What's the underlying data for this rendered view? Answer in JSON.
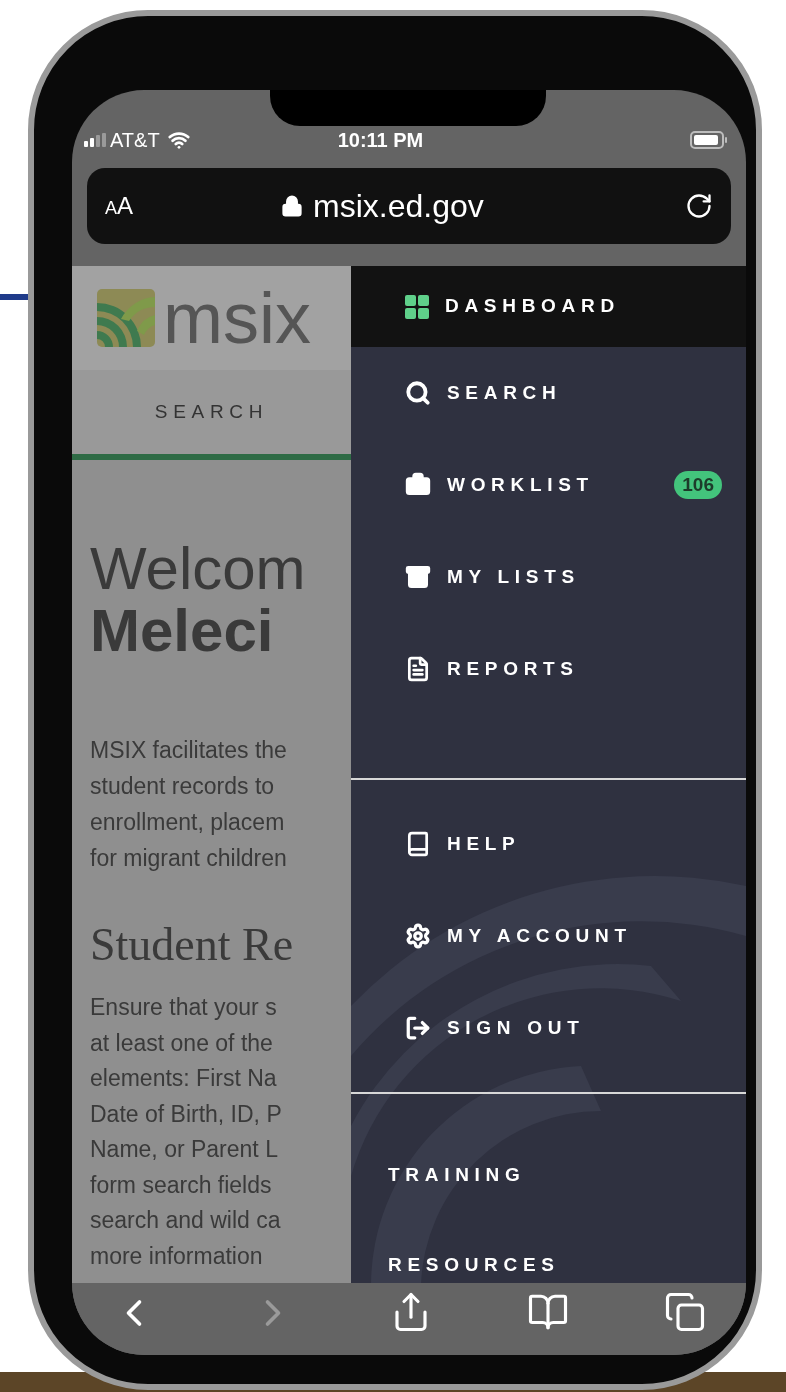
{
  "status_bar": {
    "carrier": "AT&T",
    "time": "10:11 PM"
  },
  "address_bar": {
    "text_size_button": "AA",
    "url": "msix.ed.gov"
  },
  "page": {
    "logo_text": "msix",
    "tabs": [
      {
        "label": "SEARCH",
        "selected": true
      }
    ],
    "heading_lines": [
      "Welcom",
      "Meleci"
    ],
    "intro_lines": [
      "MSIX facilitates the",
      "student records to",
      "enrollment, placem",
      "for migrant children"
    ],
    "subheading": "Student Re",
    "body_lines": [
      "Ensure that your s",
      "at least one of the",
      "elements: First Na",
      "Date of Birth, ID, P",
      "Name, or Parent L",
      "form search fields",
      "search and wild ca",
      "more information"
    ]
  },
  "menu": {
    "main_items": [
      {
        "label": "DASHBOARD",
        "selected": true
      },
      {
        "label": "SEARCH",
        "selected": false
      },
      {
        "label": "WORKLIST",
        "selected": false,
        "badge": "106"
      },
      {
        "label": "MY LISTS",
        "selected": false
      },
      {
        "label": "REPORTS",
        "selected": false
      }
    ],
    "account_items": [
      {
        "label": "HELP",
        "selected": false
      },
      {
        "label": "MY ACCOUNT",
        "selected": false
      },
      {
        "label": "SIGN OUT",
        "selected": false
      }
    ],
    "links": [
      {
        "label": "TRAINING"
      },
      {
        "label": "RESOURCES"
      }
    ]
  },
  "toolbar": {
    "back_disabled": false,
    "forward_disabled": true
  }
}
